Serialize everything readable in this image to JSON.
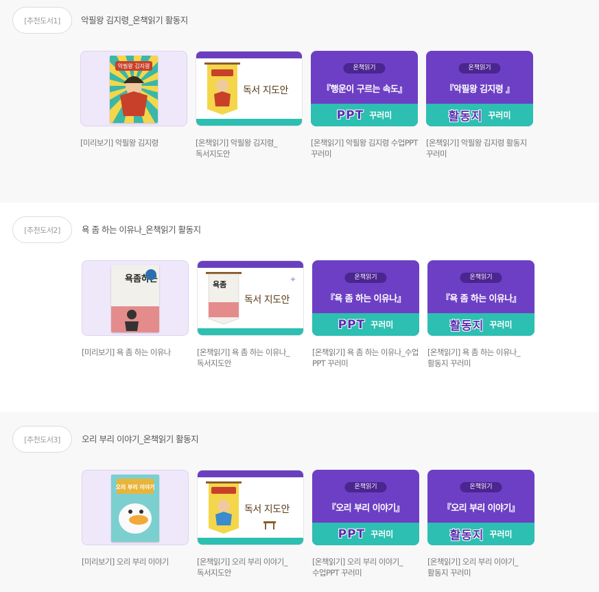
{
  "sections": [
    {
      "badge": "[추천도서1]",
      "title": "악필왕 김지령_온책읽기 활동지",
      "cards": [
        {
          "caption": "[미리보기] 악필왕 김지령",
          "cover_text": "악필왕 김지령"
        },
        {
          "caption": "[온책읽기] 악필왕 김지령_독서지도안",
          "guide_text": "독서 지도안"
        },
        {
          "caption": "[온책읽기] 악필왕 김지령 수업PPT 꾸러미",
          "pill": "온책읽기",
          "title": "『행운이 구르는 속도』",
          "big": "PPT",
          "small": "꾸러미"
        },
        {
          "caption": "[온책읽기] 악필왕 김지령 활동지 꾸러미",
          "pill": "온책읽기",
          "title": "『악필왕 김지령 』",
          "big": "활동지",
          "small": "꾸러미"
        }
      ]
    },
    {
      "badge": "[추천도서2]",
      "title": "욕 좀 하는 이유나_온책읽기 활동지",
      "cards": [
        {
          "caption": "[미리보기] 욕 좀 하는 이유나",
          "cover_text": "욕좀하는 이유나"
        },
        {
          "caption": "[온책읽기] 욕 좀 하는 이유나_독서지도안",
          "guide_text": "독서 지도안"
        },
        {
          "caption": "[온책읽기] 욕 좀 하는 이유나_수업 PPT 꾸러미",
          "pill": "온책읽기",
          "title": "『욕 좀 하는 이유나』",
          "big": "PPT",
          "small": "꾸러미"
        },
        {
          "caption": "[온책읽기] 욕 좀 하는 이유나_활동지 꾸러미",
          "pill": "온책읽기",
          "title": "『욕 좀 하는 이유나』",
          "big": "활동지",
          "small": "꾸러미"
        }
      ]
    },
    {
      "badge": "[추천도서3]",
      "title": "오리 부리 이야기_온책읽기 활동지",
      "cards": [
        {
          "caption": "[미리보기] 오리 부리 이야기",
          "cover_text": "오리 부리 이야기"
        },
        {
          "caption": "[온책읽기] 오리 부리 이야기_독서지도안",
          "guide_text": "독서 지도안"
        },
        {
          "caption": "[온책읽기] 오리 부리 이야기_수업PPT 꾸러미",
          "pill": "온책읽기",
          "title": "『오리 부리 이야기』",
          "big": "PPT",
          "small": "꾸러미"
        },
        {
          "caption": "[온책읽기] 오리 부리 이야기_활동지 꾸러미",
          "pill": "온책읽기",
          "title": "『오리 부리 이야기』",
          "big": "활동지",
          "small": "꾸러미"
        }
      ]
    }
  ]
}
